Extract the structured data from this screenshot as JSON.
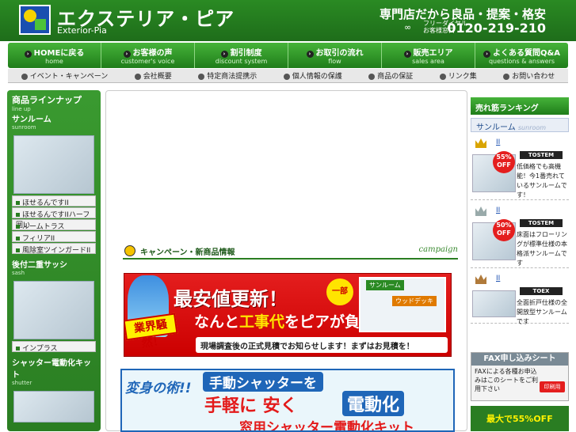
{
  "header": {
    "brand": "エクステリア・ピア",
    "brand_sub": "Exterior-Pia",
    "tagline": "専門店だから良品・提案・格安",
    "phone_label1": "フリーダイヤル",
    "phone_label2": "お客様窓口",
    "phone": "0120-219-210"
  },
  "nav": [
    {
      "title": "HOMEに戻る",
      "sub": "home"
    },
    {
      "title": "お客様の声",
      "sub": "customer's voice"
    },
    {
      "title": "割引制度",
      "sub": "discount system"
    },
    {
      "title": "お取引の流れ",
      "sub": "flow"
    },
    {
      "title": "販売エリア",
      "sub": "sales area"
    },
    {
      "title": "よくある質問Q&A",
      "sub": "questions & answers"
    }
  ],
  "subnav": [
    "イベント・キャンペーン",
    "会社概要",
    "特定商法提携示",
    "個人情報の保護",
    "商品の保証",
    "リンク集",
    "お問い合わせ"
  ],
  "sidebar": {
    "title": "商品ラインナップ",
    "title_sub": "line up",
    "cat1": {
      "title": "サンルーム",
      "sub": "sunroom"
    },
    "cat1_links": [
      "ほせるんですII",
      "ほせるんですIIハーフ囲い",
      "ルームトラス",
      "フィリアII",
      "風除室ツインガードII"
    ],
    "cat2": {
      "title": "後付二重サッシ",
      "sub": "sash"
    },
    "cat2_links": [
      "インプラス"
    ],
    "cat3": {
      "title": "シャッター電動化キット",
      "sub": "shutter"
    }
  },
  "main": {
    "campaign_title": "キャンペーン・新商品情報",
    "campaign_sub": "campaign",
    "banner1": {
      "h1": "最安値更新！",
      "h2a": "なんと",
      "h2b": "工事代",
      "h2c": "をピアが負担",
      "h3": "現場調査後の正式見積でお知らせします！まずはお見積を！",
      "badge": "業界騒然！",
      "circle": "一部",
      "room_tag": "サンルーム",
      "deck_tag": "ウッドデッキ"
    },
    "banner2": {
      "l": "変身の術!!",
      "r1": "手動シャッターを",
      "r2": "手軽に 安く",
      "r3": "電動化",
      "r4": "窓用シャッター電動化キット"
    }
  },
  "right": {
    "rank_title": "売れ筋ランキング",
    "rank_sub": "サンルーム",
    "rank_sub_en": "sunroom",
    "items": [
      {
        "name": "II",
        "off": "55% OFF",
        "brand": "TOSTEM",
        "desc": "低価格でも高機能！今1番売れているサンルームです！"
      },
      {
        "name": "II",
        "off": "50% OFF",
        "brand": "TOSTEM",
        "desc": "床面はフローリングが標準仕様の本格派サンルームです"
      },
      {
        "name": "II",
        "off": "",
        "brand": "TOEX",
        "desc": "全面折戸仕様の全開放型サンルームです"
      }
    ],
    "fax_title": "FAX申し込みシート",
    "fax_desc": "FAXによる各種お申込みはこのシートをご利用下さい",
    "fax_btn": "印刷用",
    "promo": "最大で55%OFF"
  }
}
